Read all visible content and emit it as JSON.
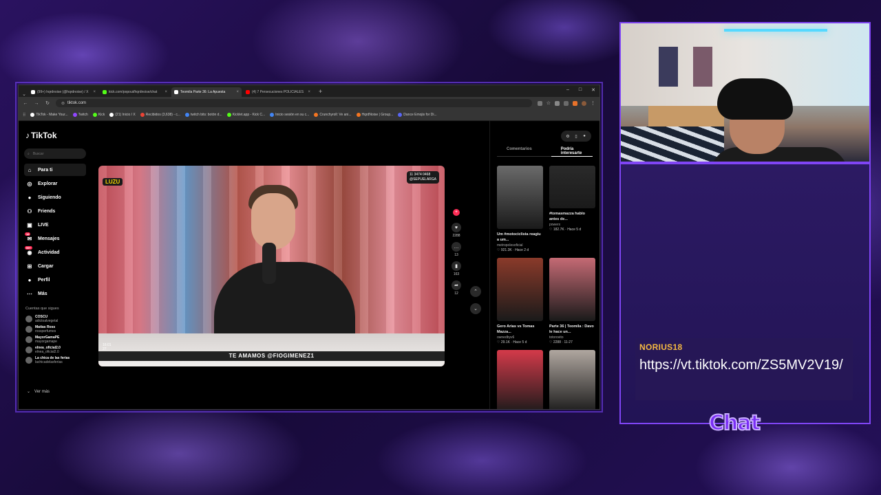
{
  "browser": {
    "tabs": [
      {
        "label": "(99+) hqrdnoise (@hqrdnoise) / X",
        "color": "#ffffff",
        "active": false
      },
      {
        "label": "kick.com/popout/hqrdnoise/chat",
        "color": "#53fc18",
        "active": false
      },
      {
        "label": "Teomila Parte 36: La Apuesta",
        "color": "#ffffff",
        "active": true
      },
      {
        "label": "(4) 7 Persecuciones POLICIALES",
        "color": "#ff0000",
        "active": false
      }
    ],
    "window_controls": [
      "–",
      "□",
      "✕"
    ],
    "url": "tiktok.com",
    "bookmarks": [
      {
        "label": "TikTok - Make Your...",
        "color": "#ffffff"
      },
      {
        "label": "Twitch",
        "color": "#9146ff"
      },
      {
        "label": "Kick",
        "color": "#53fc18"
      },
      {
        "label": "(21) Inicio / X",
        "color": "#ffffff"
      },
      {
        "label": "Recibidos (3,638) - c...",
        "color": "#ea4335"
      },
      {
        "label": "twitch bits: botón d...",
        "color": "#4285f4"
      },
      {
        "label": "Kicklet.app - Kick C...",
        "color": "#53fc18"
      },
      {
        "label": "Inicio sesión en su c...",
        "color": "#4285f4"
      },
      {
        "label": "Crunchyroll: Ve ani...",
        "color": "#f47521"
      },
      {
        "label": "HqrdNoise | Group...",
        "color": "#f47521"
      },
      {
        "label": "Dance Emojis for Di...",
        "color": "#5865f2"
      }
    ]
  },
  "tiktok": {
    "logo": "TikTok",
    "search_placeholder": "Buscar",
    "nav": [
      {
        "label": "Para ti",
        "icon": "home-icon",
        "glyph": "⌂",
        "active": true
      },
      {
        "label": "Explorar",
        "icon": "compass-icon",
        "glyph": "◎"
      },
      {
        "label": "Siguiendo",
        "icon": "following-icon",
        "glyph": "●"
      },
      {
        "label": "Friends",
        "icon": "friends-icon",
        "glyph": "⚇"
      },
      {
        "label": "LIVE",
        "icon": "live-icon",
        "glyph": "▣"
      },
      {
        "label": "Mensajes",
        "icon": "messages-icon",
        "glyph": "✉",
        "badge": "18"
      },
      {
        "label": "Actividad",
        "icon": "activity-icon",
        "glyph": "◉",
        "badge": "99+"
      },
      {
        "label": "Cargar",
        "icon": "upload-icon",
        "glyph": "⊞"
      },
      {
        "label": "Perfil",
        "icon": "profile-icon",
        "glyph": "●"
      },
      {
        "label": "Más",
        "icon": "more-icon",
        "glyph": "⋯"
      }
    ],
    "following_title": "Cuentas que sigues",
    "following": [
      {
        "name": "COSCU",
        "handle": "adictoalvegetal"
      },
      {
        "name": "Matías Ross",
        "handle": "rossperfumes"
      },
      {
        "name": "MayorGamaPE",
        "handle": "mayorgamape"
      },
      {
        "name": "elnea_oficial2.0",
        "handle": "elnea_oficial2.0"
      },
      {
        "name": "La chica de las ferias",
        "handle": "lachicadelasferias"
      }
    ],
    "see_more": "Ver más",
    "video": {
      "channel_badge": "LUZU",
      "phone_label": "11 3474 0468",
      "phone_handle": "@SEPUELARGA",
      "banner": "TE AMAMOS @FIOGIMENEZ1",
      "caption": "Parte 36 | Teomila : Davo le hace una apuesta a Toolfpeas... #fyp #viral #foryoupage #luzutv",
      "counter_top": "16:01",
      "counter_bottom": "27"
    },
    "actions": {
      "likes": "2288",
      "comments": "13",
      "saves": "163",
      "shares": "12"
    },
    "right_tabs": [
      "Comentarios",
      "Podría interesarte"
    ],
    "cards": [
      {
        "title": "Um #motociclista reagiu a um...",
        "author": "metropolesoficial",
        "views": "921.3K",
        "time": "Hace 2 d",
        "color": "#6a6a6a",
        "short": false
      },
      {
        "title": "#tomasmazza hablo antes de...",
        "author": "powerx",
        "views": "182.7K",
        "time": "Hace 5 d",
        "color": "#2a2a2a",
        "short": true
      },
      {
        "title": "Gero Arias vs Tomas Mazza...",
        "author": "ownedbyv6",
        "views": "29.1K",
        "time": "Hace 5 d",
        "color": "#8a3a2a",
        "short": false
      },
      {
        "title": "Parte 36 | Teomila : Davo le hace un...",
        "author": "totorovito",
        "views": "2288",
        "time": "11-27",
        "color": "#c56a74",
        "short": false
      },
      {
        "title": "",
        "author": "",
        "views": "",
        "time": "",
        "color": "#d43a4a",
        "short": false
      },
      {
        "title": "",
        "author": "",
        "views": "",
        "time": "",
        "color": "#b0a7a0",
        "short": false
      }
    ]
  },
  "chat": {
    "username": "NORIUS18",
    "message": "https://vt.tiktok.com/ZS5MV2V19/",
    "label": "Chat"
  }
}
